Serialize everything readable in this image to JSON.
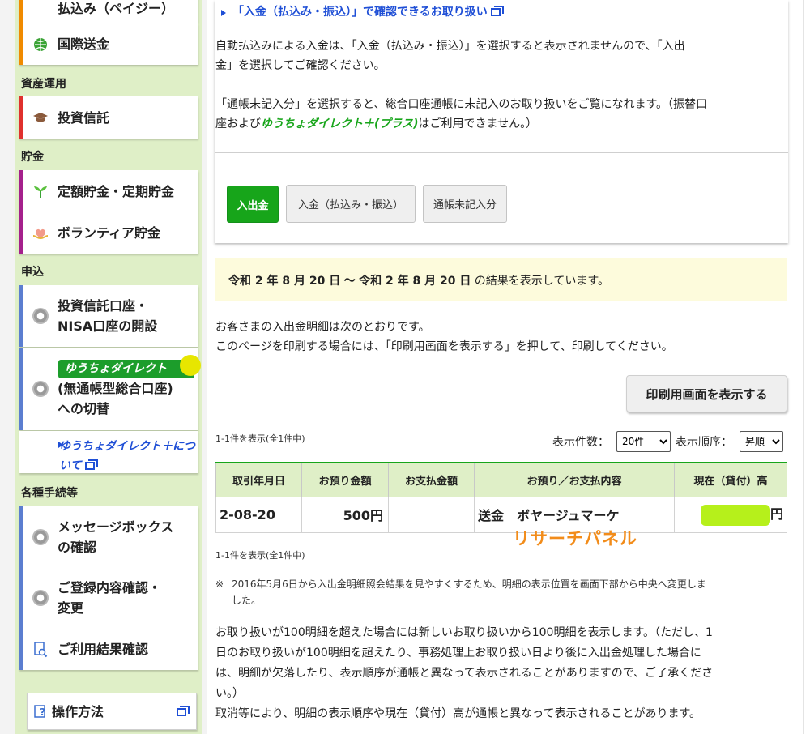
{
  "sidebar": {
    "items": [
      {
        "label": "払込み（ペイジー）",
        "icon": "payment-icon"
      },
      {
        "label": "国際送金",
        "icon": "globe-icon"
      },
      {
        "label": "投資信託",
        "icon": "graduation-cap-icon"
      },
      {
        "label": "定額貯金・定期貯金",
        "icon": "sprout-icon"
      },
      {
        "label": "ボランティア貯金",
        "icon": "heart-hands-icon"
      },
      {
        "label": "投資信託口座・NISA口座の開設",
        "line1": "投資信託口座・",
        "line2": "NISA口座の開設",
        "icon": "gear-icon"
      },
      {
        "label": "(無通帳型総合口座)への切替",
        "logo": "ゆうちょダイレクト",
        "line1": "(無通帳型総合口座)",
        "line2": "への切替",
        "icon": "gear-icon"
      },
      {
        "label": "メッセージボックスの確認",
        "line1": "メッセージボックス",
        "line2": "の確認",
        "icon": "gear-icon"
      },
      {
        "label": "ご登録内容確認・変更",
        "line1": "ご登録内容確認・",
        "line2": "変更",
        "icon": "gear-icon"
      },
      {
        "label": "ご利用結果確認",
        "icon": "document-search-icon"
      },
      {
        "label": "操作方法",
        "icon": "help-icon"
      }
    ],
    "categories": [
      "資産運用",
      "貯金",
      "申込",
      "各種手続等"
    ],
    "sub_link": {
      "line1": "ゆうちょダイレクト＋につ",
      "line2": "いて"
    }
  },
  "panel": {
    "link": "「入金（払込み・振込）」で確認できるお取り扱い",
    "p1_line1": "自動払込みによる入金は、「入金（払込み・振込）」を選択すると表示されませんので、「入出",
    "p1_line2": "金」を選択してご確認ください。",
    "p2_line1": "「通帳未記入分」を選択すると、総合口座通帳に未記入のお取り扱いをご覧になれます。（振替口",
    "p2_line2_a": "座および",
    "p2_line2_b": "ゆうちょダイレクト＋(プラス)",
    "p2_line2_c": "はご利用できません。）",
    "tabs": [
      "入出金",
      "入金（払込み・振込）",
      "通帳未記入分"
    ]
  },
  "period": {
    "from": "令和 2 年 8 月 20 日",
    "sep": "〜",
    "to": "令和 2 年 8 月 20 日",
    "suffix": "の結果を表示しています。"
  },
  "intro_line1": "お客さまの入出金明細は次のとおりです。",
  "intro_line2": "このページを印刷する場合には、「印刷用画面を表示する」を押して、印刷してください。",
  "print_button": "印刷用画面を表示する",
  "count_text": "1-1件を表示(全1件中)",
  "count_label": "表示件数：",
  "count_value": "20件",
  "order_label": "表示順序：",
  "order_value": "昇順",
  "table": {
    "headers": [
      "取引年月日",
      "お預り金額",
      "お支払金額",
      "お預り／お支払内容",
      "現在（貸付）高"
    ],
    "rows": [
      {
        "date": "2-08-20",
        "deposit": "500円",
        "payment": "",
        "content": "送金　ボヤージュマーケ",
        "balance_suffix": "円"
      }
    ]
  },
  "watermark": "リサーチパネル",
  "notes": {
    "n1_mark": "※",
    "n1_line1": "2016年5月6日から入出金明細照会結果を見やすくするため、明細の表示位置を画面下部から中央へ変更しま",
    "n1_line2": "した。",
    "n2_line1": "お取り扱いが100明細を超えた場合には新しいお取り扱いから100明細を表示します。（ただし、1",
    "n2_line2": "日のお取り扱いが100明細を超えたり、事務処理上お取り扱い日より後に入出金処理した場合に",
    "n2_line3": "は、明細が欠落したり、表示順序が通帳と異なって表示されることがありますので、ご了承くださ",
    "n2_line4": "い。）",
    "n3": "取消等により、明細の表示順序や現在（貸付）高が通帳と異なって表示されることがあります。"
  },
  "colors": {
    "accent_green": "#17a51a",
    "sidebar_bg": "#dfefc7",
    "link_blue": "#1f4fd6",
    "notice_bg": "#fdfbdc",
    "watermark": "#f28c1a"
  }
}
